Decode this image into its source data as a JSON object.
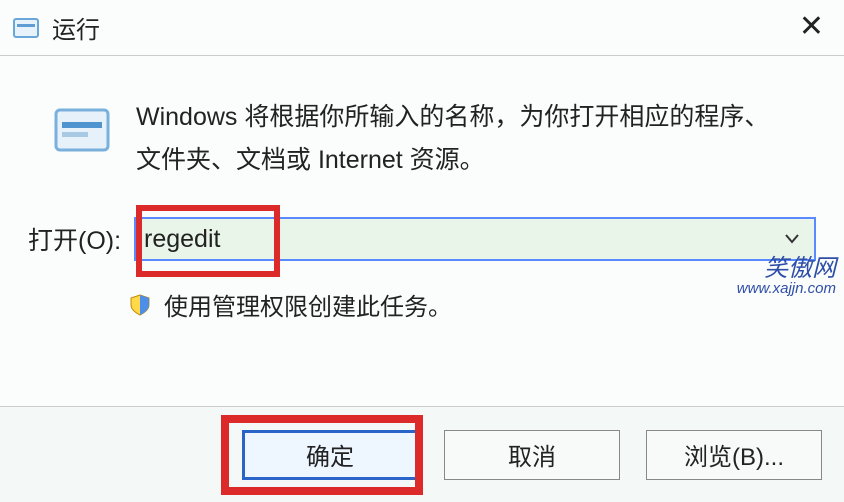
{
  "titlebar": {
    "title": "运行"
  },
  "message": "Windows 将根据你所输入的名称，为你打开相应的程序、文件夹、文档或 Internet 资源。",
  "open": {
    "label": "打开(O):",
    "value": "regedit"
  },
  "admin_note": "使用管理权限创建此任务。",
  "buttons": {
    "ok": "确定",
    "cancel": "取消",
    "browse": "浏览(B)..."
  },
  "watermark": {
    "line1": "笑傲网",
    "line2": "www.xajjn.com"
  }
}
